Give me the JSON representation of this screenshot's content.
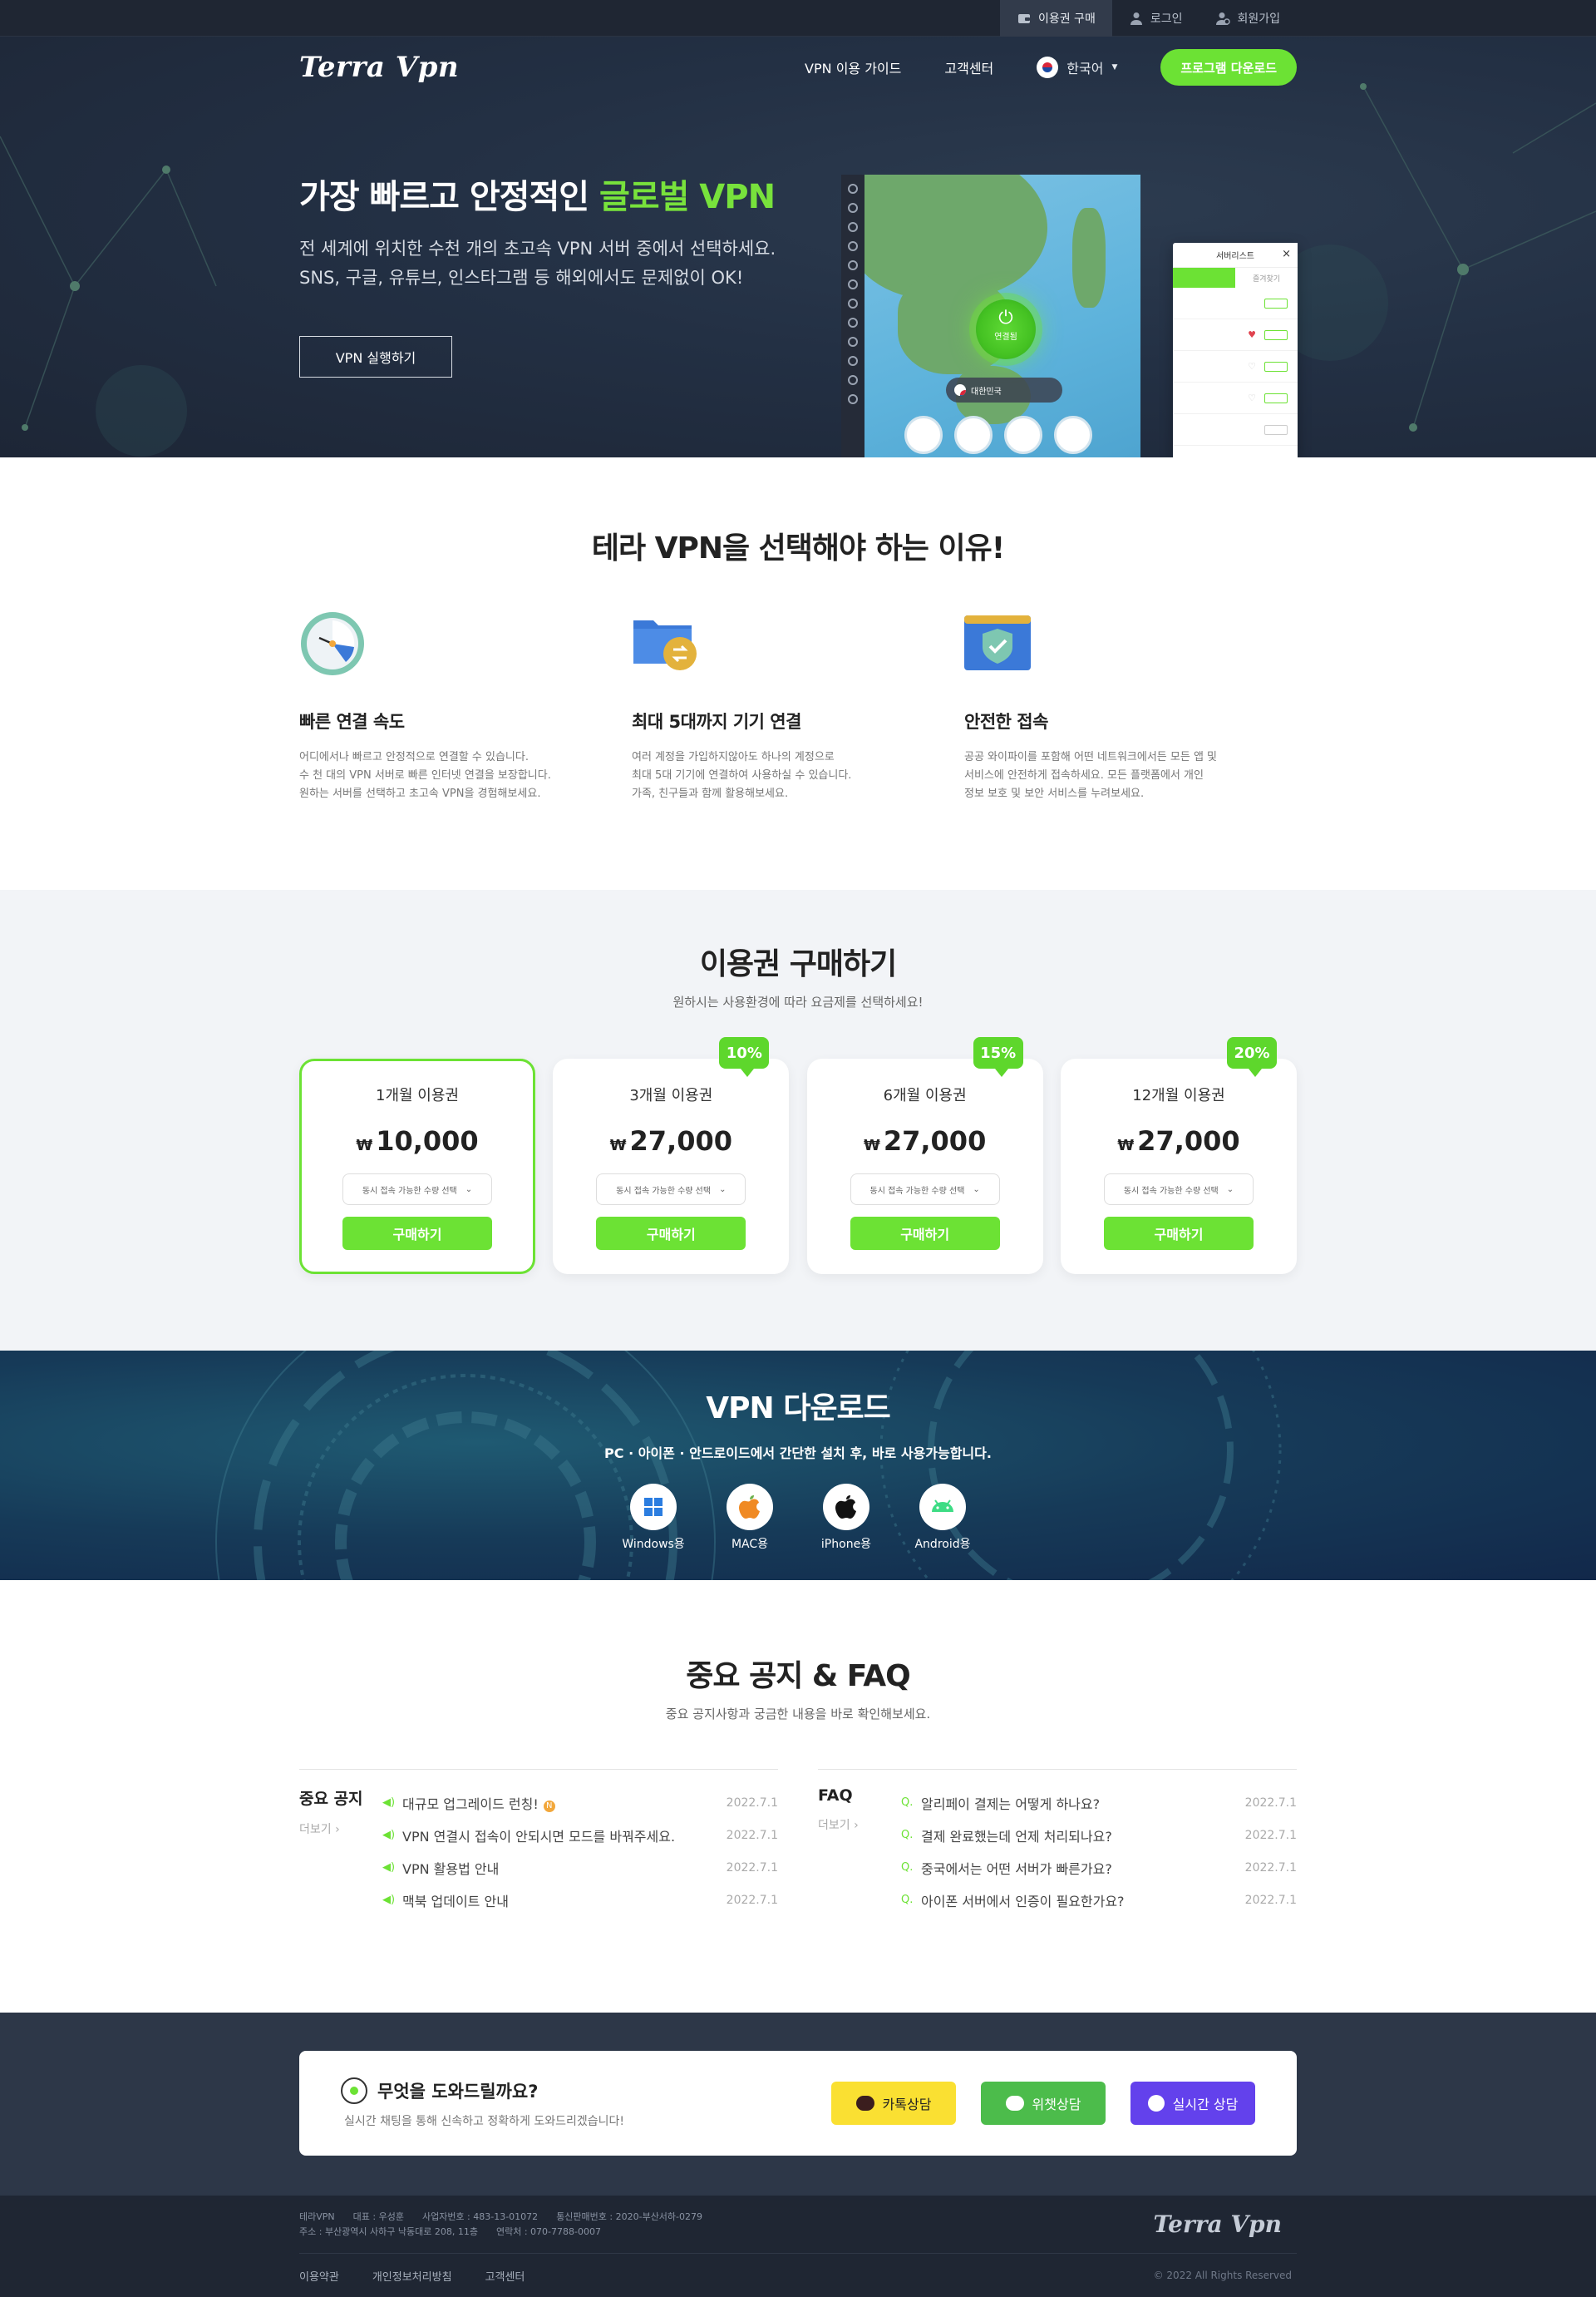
{
  "topbar": {
    "items": [
      {
        "label": "이용권 구매",
        "icon": "wallet-icon"
      },
      {
        "label": "로그인",
        "icon": "user-icon"
      },
      {
        "label": "회원가입",
        "icon": "user-add-icon"
      }
    ]
  },
  "nav": {
    "logo": "Terra Vpn",
    "menu": [
      "VPN 이용 가이드",
      "고객센터"
    ],
    "language": "한국어",
    "download_button": "프로그램 다운로드"
  },
  "hero": {
    "title_prefix": "가장 빠르고 안정적인 ",
    "title_highlight": "글로벌 VPN",
    "subtitle_line1": "전 세계에 위치한 수천 개의 초고속 VPN 서버 중에서 선택하세요.",
    "subtitle_line2": "SNS, 구글, 유튜브, 인스타그램 등 해외에서도 문제없이 OK!",
    "cta": "VPN 실행하기",
    "app_panel_title": "서버리스트",
    "app_panel_tab": "즐겨찾기",
    "app_power_label": "연결됨",
    "app_location": "대한민국"
  },
  "why": {
    "title": "테라 VPN을 선택해야 하는 이유!",
    "features": [
      {
        "icon": "clock-icon",
        "title": "빠른 연결 속도",
        "desc": "어디에서나 빠르고 안정적으로 연결할 수 있습니다.\n수 천 대의 VPN 서버로 빠른 인터넷 연결을 보장합니다.\n원하는 서버를 선택하고 초고속 VPN을 경험해보세요."
      },
      {
        "icon": "folder-sync-icon",
        "title": "최대 5대까지 기기 연결",
        "desc": "여러 계정을 가입하지않아도 하나의 계정으로\n최대 5대 기기에 연결하여 사용하실 수 있습니다.\n가족, 친구들과 함께 활용해보세요."
      },
      {
        "icon": "shield-check-icon",
        "title": "안전한 접속",
        "desc": "공공 와이파이를 포함해 어떤 네트워크에서든 모든 앱 및\n서비스에 안전하게 접속하세요. 모든 플랫폼에서 개인\n정보 보호 및 보안 서비스를 누려보세요."
      }
    ]
  },
  "pricing": {
    "title": "이용권 구매하기",
    "subtitle": "원하시는 사용환경에 따라 요금제를 선택하세요!",
    "currency": "₩",
    "select_placeholder": "동시 접속 가능한 수량 선택",
    "buy_label": "구매하기",
    "plans": [
      {
        "name": "1개월 이용권",
        "price": "10,000",
        "badge": ""
      },
      {
        "name": "3개월 이용권",
        "price": "27,000",
        "badge": "10%"
      },
      {
        "name": "6개월 이용권",
        "price": "27,000",
        "badge": "15%"
      },
      {
        "name": "12개월 이용권",
        "price": "27,000",
        "badge": "20%"
      }
    ]
  },
  "download": {
    "title": "VPN 다운로드",
    "subtitle": "PC · 아이폰 · 안드로이드에서 간단한 설치 후, 바로 사용가능합니다.",
    "platforms": [
      {
        "label": "Windows용",
        "icon": "windows-icon"
      },
      {
        "label": "MAC용",
        "icon": "apple-color-icon"
      },
      {
        "label": "iPhone용",
        "icon": "apple-icon"
      },
      {
        "label": "Android용",
        "icon": "android-icon"
      }
    ]
  },
  "board": {
    "title": "중요 공지 & FAQ",
    "subtitle": "중요 공지사항과 궁금한 내용을 바로 확인해보세요.",
    "more": "더보기",
    "notice": {
      "heading": "중요 공지",
      "items": [
        {
          "text": "대규모 업그레이드 런칭!",
          "date": "2022.7.1",
          "new": "N"
        },
        {
          "text": "VPN 연결시 접속이 안되시면 모드를 바꿔주세요.",
          "date": "2022.7.1"
        },
        {
          "text": "VPN 활용법 안내",
          "date": "2022.7.1"
        },
        {
          "text": "맥북 업데이트 안내",
          "date": "2022.7.1"
        }
      ]
    },
    "faq": {
      "heading": "FAQ",
      "prefix": "Q.",
      "items": [
        {
          "text": "알리페이 결제는 어떻게 하나요?",
          "date": "2022.7.1"
        },
        {
          "text": "결제 완료했는데 언제 처리되나요?",
          "date": "2022.7.1"
        },
        {
          "text": "중국에서는 어떤 서버가 빠른가요?",
          "date": "2022.7.1"
        },
        {
          "text": "아이폰 서버에서 인증이 필요한가요?",
          "date": "2022.7.1"
        }
      ]
    }
  },
  "help": {
    "title": "무엇을 도와드릴까요?",
    "subtitle": "실시간 채팅을 통해 신속하고 정확하게 도와드리겠습니다!",
    "buttons": [
      {
        "label": "카톡상담",
        "icon": "kakao-talk-icon"
      },
      {
        "label": "위챗상담",
        "icon": "wechat-icon"
      },
      {
        "label": "실시간 상담",
        "icon": "live-chat-icon"
      }
    ]
  },
  "footer": {
    "line1": [
      "테라VPN",
      "대표 : 우성훈",
      "사업자번호 : 483-13-01072",
      "통신판매번호 : 2020-부산서하-0279"
    ],
    "line2": [
      "주소 : 부산광역시 사하구 낙동대로 208, 11층",
      "연락처 : 070-7788-0007"
    ],
    "logo": "Terra Vpn",
    "links": [
      "이용약관",
      "개인정보처리방침",
      "고객센터"
    ],
    "copyright": "© 2022 All Rights Reserved"
  },
  "colors": {
    "accent": "#6ce234",
    "dark": "#1f2633",
    "kakao": "#fae032",
    "wechat": "#4cbc4b",
    "live": "#6341ec"
  }
}
